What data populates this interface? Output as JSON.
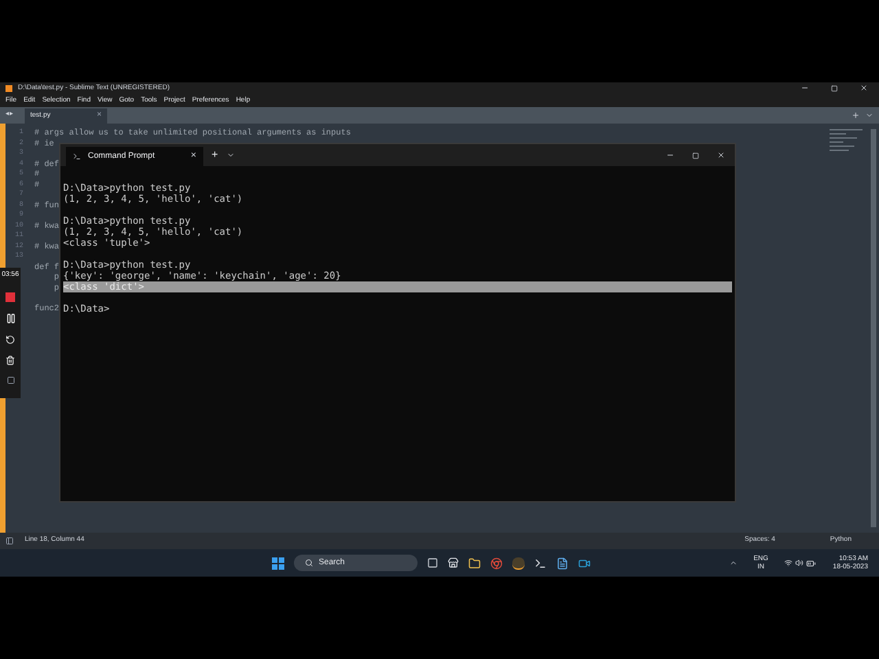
{
  "editor": {
    "title": "D:\\Data\\test.py - Sublime Text (UNREGISTERED)",
    "menu": [
      "File",
      "Edit",
      "Selection",
      "Find",
      "View",
      "Goto",
      "Tools",
      "Project",
      "Preferences",
      "Help"
    ],
    "tab_nav": "◂▸",
    "tab": "test.py",
    "tab_close": "×",
    "lines": [
      {
        "kind": "code",
        "number": "1",
        "text": "# args allow us to take unlimited positional arguments as inputs"
      },
      {
        "kind": "code",
        "number": "2",
        "text": "# ie"
      },
      {
        "kind": "blank",
        "number": "3"
      },
      {
        "kind": "code",
        "number": "4",
        "text": "# def"
      },
      {
        "kind": "code",
        "number": "5",
        "text": "#"
      },
      {
        "kind": "code",
        "number": "6",
        "text": "#"
      },
      {
        "kind": "blank",
        "number": "7"
      },
      {
        "kind": "code",
        "number": "8",
        "text": "# fun"
      },
      {
        "kind": "blank",
        "number": "9"
      },
      {
        "kind": "code",
        "number": "10",
        "text": "# kwa"
      },
      {
        "kind": "blank",
        "number": "11"
      },
      {
        "kind": "code",
        "number": "12",
        "text": "# kwa"
      },
      {
        "kind": "blank",
        "number": "13"
      },
      {
        "kind": "code",
        "text": "def f"
      },
      {
        "kind": "code",
        "text": "    p"
      },
      {
        "kind": "code",
        "text": "    p"
      },
      {
        "kind": "blank"
      },
      {
        "kind": "code",
        "text": "func2"
      }
    ],
    "status_left": "Line 18, Column 44",
    "status_spaces": "Spaces: 4",
    "status_syntax": "Python"
  },
  "recorder": {
    "time": "03:56"
  },
  "terminal": {
    "tab": "Command Prompt",
    "tab_close": "×",
    "new_tab": "+",
    "lines": [
      {
        "kind": "text",
        "text": "D:\\Data>python test.py",
        "selected": false
      },
      {
        "kind": "text",
        "text": "(1, 2, 3, 4, 5, 'hello', 'cat')",
        "selected": false
      },
      {
        "kind": "blank"
      },
      {
        "kind": "text",
        "text": "D:\\Data>python test.py",
        "selected": false
      },
      {
        "kind": "text",
        "text": "(1, 2, 3, 4, 5, 'hello', 'cat')",
        "selected": false
      },
      {
        "kind": "text",
        "text": "<class 'tuple'>",
        "selected": false
      },
      {
        "kind": "blank"
      },
      {
        "kind": "text",
        "text": "D:\\Data>python test.py",
        "selected": false
      },
      {
        "kind": "text",
        "text": "{'key': 'george', 'name': 'keychain', 'age': 20}",
        "selected": false
      },
      {
        "kind": "text",
        "text": "<class 'dict'>",
        "selected": true
      },
      {
        "kind": "blank"
      },
      {
        "kind": "text",
        "text": "D:\\Data>",
        "selected": false
      }
    ]
  },
  "taskbar": {
    "search": "Search",
    "language": "ENG",
    "region": "IN",
    "time": "10:53 AM",
    "date": "18-05-2023"
  }
}
